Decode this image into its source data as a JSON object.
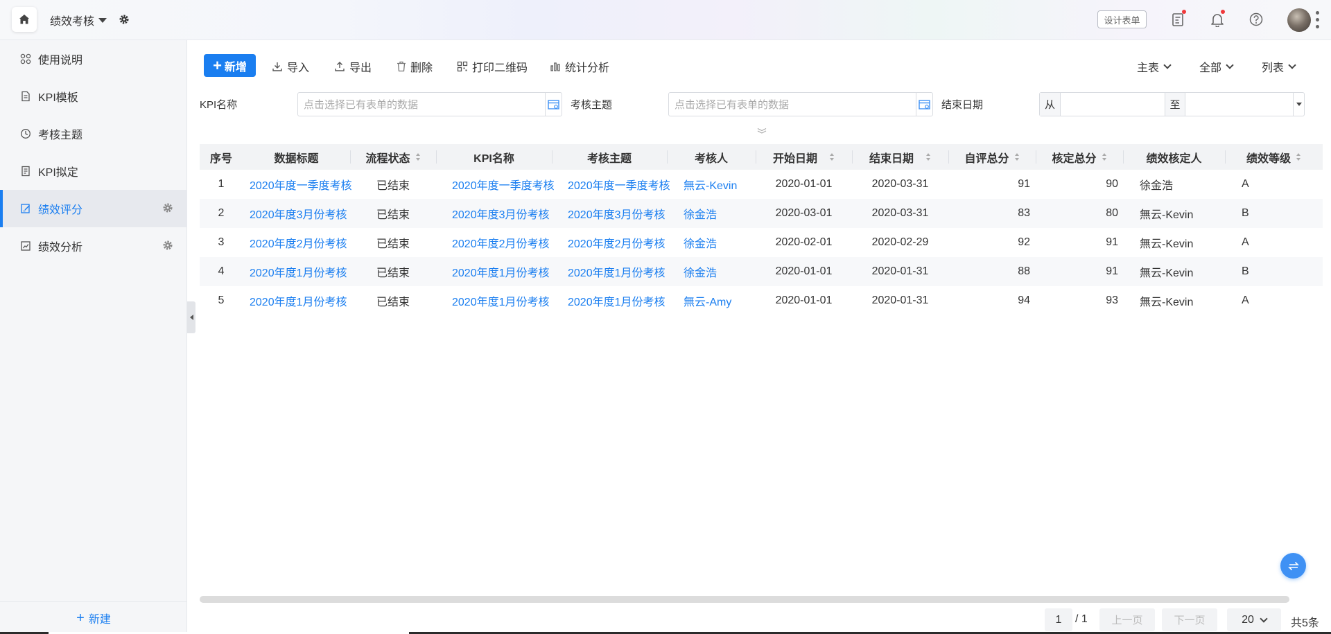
{
  "topbar": {
    "app_title": "绩效考核",
    "design_button": "设计表单"
  },
  "sidebar": {
    "items": [
      {
        "label": "使用说明",
        "icon": "grid-icon"
      },
      {
        "label": "KPI模板",
        "icon": "document-icon"
      },
      {
        "label": "考核主题",
        "icon": "clock-icon"
      },
      {
        "label": "KPI拟定",
        "icon": "document-list-icon"
      },
      {
        "label": "绩效评分",
        "icon": "edit-form-icon",
        "active": true
      },
      {
        "label": "绩效分析",
        "icon": "chart-icon"
      }
    ],
    "new_label": "新建"
  },
  "toolbar": {
    "new_label": "新增",
    "import_label": "导入",
    "export_label": "导出",
    "delete_label": "删除",
    "qrcode_label": "打印二维码",
    "stats_label": "统计分析",
    "view_main": "主表",
    "view_scope": "全部",
    "view_mode": "列表"
  },
  "filters": {
    "kpi_label": "KPI名称",
    "kpi_placeholder": "点击选择已有表单的数据",
    "theme_label": "考核主题",
    "theme_placeholder": "点击选择已有表单的数据",
    "end_date_label": "结束日期",
    "from_label": "从",
    "to_label": "至"
  },
  "table": {
    "columns": [
      "序号",
      "数据标题",
      "流程状态",
      "KPI名称",
      "考核主题",
      "考核人",
      "开始日期",
      "结束日期",
      "自评总分",
      "核定总分",
      "绩效核定人",
      "绩效等级"
    ],
    "rows": [
      [
        "1",
        "2020年度一季度考核",
        "已结束",
        "2020年度一季度考核",
        "2020年度一季度考核",
        "無云-Kevin",
        "2020-01-01",
        "2020-03-31",
        "91",
        "90",
        "徐金浩",
        "A"
      ],
      [
        "2",
        "2020年度3月份考核",
        "已结束",
        "2020年度3月份考核",
        "2020年度3月份考核",
        "徐金浩",
        "2020-03-01",
        "2020-03-31",
        "83",
        "80",
        "無云-Kevin",
        "B"
      ],
      [
        "3",
        "2020年度2月份考核",
        "已结束",
        "2020年度2月份考核",
        "2020年度2月份考核",
        "徐金浩",
        "2020-02-01",
        "2020-02-29",
        "92",
        "91",
        "無云-Kevin",
        "A"
      ],
      [
        "4",
        "2020年度1月份考核",
        "已结束",
        "2020年度1月份考核",
        "2020年度1月份考核",
        "徐金浩",
        "2020-01-01",
        "2020-01-31",
        "88",
        "91",
        "無云-Kevin",
        "B"
      ],
      [
        "5",
        "2020年度1月份考核",
        "已结束",
        "2020年度1月份考核",
        "2020年度1月份考核",
        "無云-Amy",
        "2020-01-01",
        "2020-01-31",
        "94",
        "93",
        "無云-Kevin",
        "A"
      ]
    ]
  },
  "pagination": {
    "current_page": "1",
    "total_pages": "/ 1",
    "prev_label": "上一页",
    "next_label": "下一页",
    "page_size": "20",
    "total_count": "共5条"
  },
  "colors": {
    "accent": "#1a7ef0",
    "notification": "#f0383b"
  }
}
